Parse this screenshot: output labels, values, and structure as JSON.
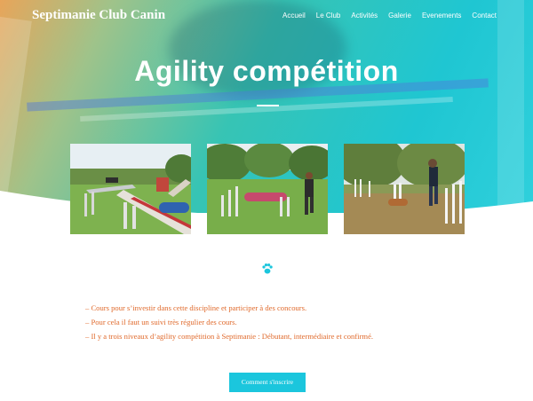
{
  "site": {
    "logo": "Septimanie Club Canin"
  },
  "nav": [
    {
      "label": "Accueil"
    },
    {
      "label": "Le Club"
    },
    {
      "label": "Activités"
    },
    {
      "label": "Galerie"
    },
    {
      "label": "Evenements"
    },
    {
      "label": "Contact"
    }
  ],
  "hero": {
    "title": "Agility compétition"
  },
  "gallery": [
    {
      "subject": "agility-field-photo-1"
    },
    {
      "subject": "agility-field-photo-2"
    },
    {
      "subject": "agility-field-photo-3"
    }
  ],
  "content": {
    "icon": "paw-icon",
    "bullets": [
      "– Cours pour s’investir dans cette discipline et participer à des concours.",
      "– Pour cela il faut un suivi très régulier des cours.",
      "– Il y a trois niveaux d’agility compétition à Septimanie : Débutant, intermédiaire et confirmé."
    ]
  },
  "cta": {
    "label": "Comment s'inscrire"
  },
  "colors": {
    "accent": "#1bc6dd",
    "text_orange": "#e06a2c"
  }
}
